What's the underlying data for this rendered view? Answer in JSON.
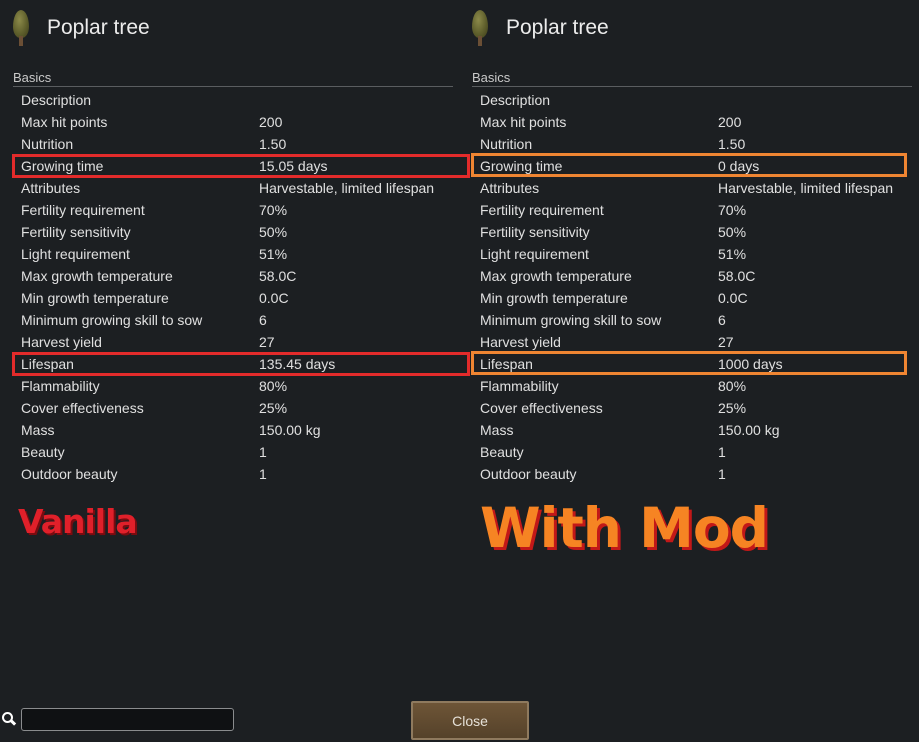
{
  "left_panel": {
    "title": "Poplar tree",
    "section": "Basics",
    "stats": [
      {
        "label": "Description",
        "value": ""
      },
      {
        "label": "Max hit points",
        "value": "200"
      },
      {
        "label": "Nutrition",
        "value": "1.50"
      },
      {
        "label": "Growing time",
        "value": "15.05 days"
      },
      {
        "label": "Attributes",
        "value": "Harvestable, limited lifespan"
      },
      {
        "label": "Fertility requirement",
        "value": "70%"
      },
      {
        "label": "Fertility sensitivity",
        "value": "50%"
      },
      {
        "label": "Light requirement",
        "value": "51%"
      },
      {
        "label": "Max growth temperature",
        "value": "58.0C"
      },
      {
        "label": "Min growth temperature",
        "value": "0.0C"
      },
      {
        "label": "Minimum growing skill to sow",
        "value": "6"
      },
      {
        "label": "Harvest yield",
        "value": "27"
      },
      {
        "label": "Lifespan",
        "value": "135.45 days"
      },
      {
        "label": "Flammability",
        "value": "80%"
      },
      {
        "label": "Cover effectiveness",
        "value": "25%"
      },
      {
        "label": "Mass",
        "value": "150.00 kg"
      },
      {
        "label": "Beauty",
        "value": "1"
      },
      {
        "label": "Outdoor beauty",
        "value": "1"
      }
    ],
    "stamp": "Vanilla",
    "highlight_color": "#e32b2b"
  },
  "right_panel": {
    "title": "Poplar tree",
    "section": "Basics",
    "stats": [
      {
        "label": "Description",
        "value": ""
      },
      {
        "label": "Max hit points",
        "value": "200"
      },
      {
        "label": "Nutrition",
        "value": "1.50"
      },
      {
        "label": "Growing time",
        "value": "0 days"
      },
      {
        "label": "Attributes",
        "value": "Harvestable, limited lifespan"
      },
      {
        "label": "Fertility requirement",
        "value": "70%"
      },
      {
        "label": "Fertility sensitivity",
        "value": "50%"
      },
      {
        "label": "Light requirement",
        "value": "51%"
      },
      {
        "label": "Max growth temperature",
        "value": "58.0C"
      },
      {
        "label": "Min growth temperature",
        "value": "0.0C"
      },
      {
        "label": "Minimum growing skill to sow",
        "value": "6"
      },
      {
        "label": "Harvest yield",
        "value": "27"
      },
      {
        "label": "Lifespan",
        "value": "1000 days"
      },
      {
        "label": "Flammability",
        "value": "80%"
      },
      {
        "label": "Cover effectiveness",
        "value": "25%"
      },
      {
        "label": "Mass",
        "value": "150.00 kg"
      },
      {
        "label": "Beauty",
        "value": "1"
      },
      {
        "label": "Outdoor beauty",
        "value": "1"
      }
    ],
    "stamp": "With Mod",
    "highlight_color": "#ef8532"
  },
  "highlighted_rows": [
    "Growing time",
    "Lifespan"
  ],
  "search": {
    "placeholder": "",
    "value": "",
    "icon": "search-icon"
  },
  "close_button": {
    "label": "Close"
  },
  "tree_icon": "poplar-tree-icon",
  "colors": {
    "background": "#1c1f22",
    "vanilla_text": "#e0202a",
    "mod_text": "#f68423",
    "button": "#6e5537"
  }
}
